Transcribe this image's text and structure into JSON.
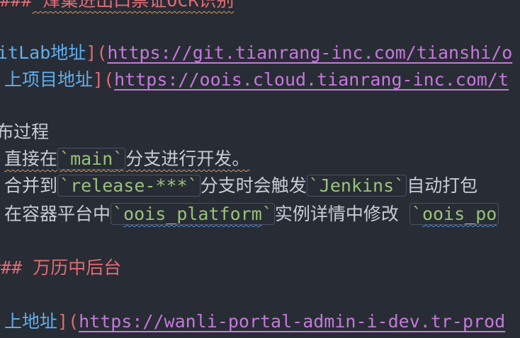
{
  "editor": {
    "line1": {
      "hash": "###",
      "heading": " 烽巢进出口票证OCR识别"
    },
    "line2": {
      "link_text": "itLab地址",
      "open_paren": "](",
      "url": "https://git.tianrang-inc.com/tianshi/o"
    },
    "line3": {
      "link_text": "上项目地址",
      "open_paren": "](",
      "url": "https://oois.cloud.tianrang-inc.com/t"
    },
    "line4": {
      "text": "布过程"
    },
    "line5": {
      "prefix": "直接在",
      "code": "main",
      "suffix": "分支进行开发。"
    },
    "line6": {
      "prefix": "合并到",
      "code1": "release-***",
      "middle": "分支时会触发",
      "code2": "Jenkins",
      "suffix": "自动打包"
    },
    "line7": {
      "prefix": "在容器平台中",
      "code1": "oois_platform",
      "middle": "实例详情中修改 ",
      "code2": "oois_po"
    },
    "line8": {
      "hash": "###",
      "heading": " 万历中后台"
    },
    "line9": {
      "link_text": "上地址",
      "open_paren": "](",
      "url": "https://wanli-portal-admin-i-dev.tr-prod"
    }
  },
  "colors": {
    "background": "#282c34",
    "heading": "#e06c75",
    "link_text": "#61afef",
    "url": "#c678dd",
    "code": "#98c379",
    "spell_warning": "#d19a66",
    "spell_error": "#4d8ee8"
  }
}
